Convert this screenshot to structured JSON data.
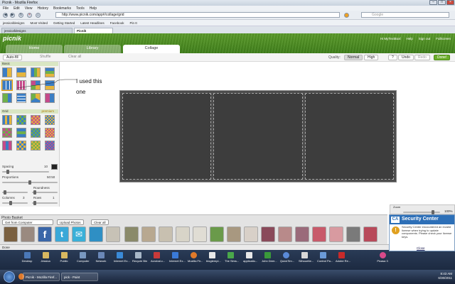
{
  "browser": {
    "title": "Picnik - Mozilla Firefox",
    "menu": [
      "File",
      "Edit",
      "View",
      "History",
      "Bookmarks",
      "Tools",
      "Help"
    ],
    "url": "http://www.picnik.com/app#/collage/grid",
    "search_placeholder": "Google",
    "bookmarks": [
      "jessicafdesigns",
      "Most Visited",
      "Getting Started",
      "Latest Headlines",
      "Facebook",
      "Pin It"
    ],
    "tabs": [
      "jessicafdesigns",
      "Picnik"
    ]
  },
  "picnik": {
    "logo": "picnik",
    "header_links": [
      "Hi MyTextBoxl",
      "Help",
      "Sign out",
      "Fullscreen"
    ],
    "tabs": [
      "Home",
      "Library",
      "Collage"
    ],
    "toolbar": {
      "autofill": "Auto-fill",
      "shuffle": "Shuffle",
      "clear": "Clear all",
      "quality_label": "Quality:",
      "quality_normal": "Normal",
      "quality_high": "High",
      "help": "?",
      "undo": "Undo",
      "redo": "Redo",
      "done": "Done!"
    },
    "left": {
      "basic": "Basic",
      "grid": "Grid",
      "premium": "premium",
      "spacing": "Spacing",
      "spacing_value": "10",
      "proportions": "Proportions",
      "proportions_value": "50:50",
      "roundness": "Roundness",
      "columns": "Columns",
      "columns_value": "3",
      "rows": "Rows",
      "rows_value": "1"
    },
    "annotation": "I used this one",
    "zoom_label": "Zoom",
    "zoom_value": "100%",
    "basket": {
      "title": "Photo Basket",
      "source": "Get from Computer",
      "upload": "Upload Photos",
      "clear": "Clear all"
    }
  },
  "status": "Done",
  "desktop_icons": [
    "Desktop",
    "Jessica",
    "Public",
    "Computer",
    "Network",
    "Internet Ex...",
    "Recycle Bin",
    "Acrobat.c...",
    "Internet Ex...",
    "Mozilla Fir...",
    "blogtempl...",
    "The Sims...",
    "applicatio...",
    "John Deer...",
    "QuickTim...",
    "Silhouette...",
    "Control Pa...",
    "Adobe Re...",
    "Picasa 3"
  ],
  "taskbar": {
    "items": [
      "Picnik - Mozilla Firef...",
      "pick - Paint"
    ],
    "time": "8:43 AM",
    "date": "6/30/2011"
  },
  "security": {
    "badge": "CA",
    "title": "Security Center",
    "body": "Security Center encountered an invalid license when trying to update components. Please check your license keys.",
    "close": "Close"
  }
}
